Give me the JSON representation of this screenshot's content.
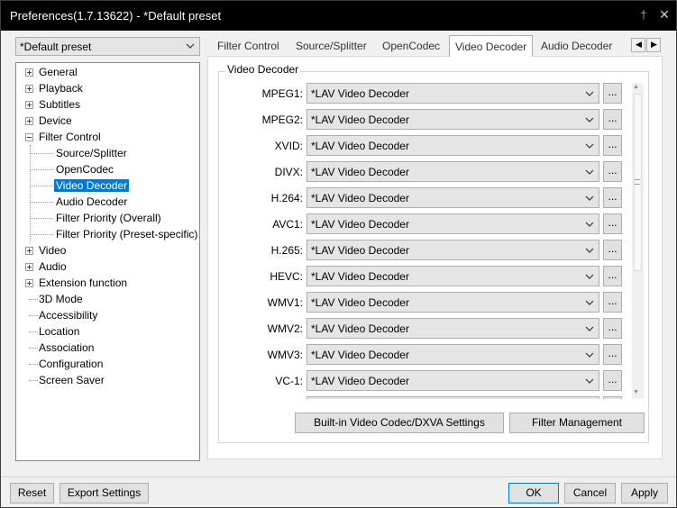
{
  "window": {
    "title": "Preferences(1.7.13622) - *Default preset"
  },
  "preset": {
    "value": "*Default preset"
  },
  "tree": {
    "items": [
      {
        "label": "General"
      },
      {
        "label": "Playback"
      },
      {
        "label": "Subtitles"
      },
      {
        "label": "Device"
      },
      {
        "label": "Filter Control"
      },
      {
        "label": "Source/Splitter"
      },
      {
        "label": "OpenCodec"
      },
      {
        "label": "Video Decoder"
      },
      {
        "label": "Audio Decoder"
      },
      {
        "label": "Filter Priority (Overall)"
      },
      {
        "label": "Filter Priority (Preset-specific)"
      },
      {
        "label": "Video"
      },
      {
        "label": "Audio"
      },
      {
        "label": "Extension function"
      },
      {
        "label": "3D Mode"
      },
      {
        "label": "Accessibility"
      },
      {
        "label": "Location"
      },
      {
        "label": "Association"
      },
      {
        "label": "Configuration"
      },
      {
        "label": "Screen Saver"
      }
    ]
  },
  "tabs": [
    {
      "label": "Filter Control"
    },
    {
      "label": "Source/Splitter"
    },
    {
      "label": "OpenCodec"
    },
    {
      "label": "Video Decoder"
    },
    {
      "label": "Audio Decoder"
    }
  ],
  "group": {
    "title": "Video Decoder"
  },
  "decoders": [
    {
      "label": "MPEG1:",
      "value": "*LAV Video Decoder"
    },
    {
      "label": "MPEG2:",
      "value": "*LAV Video Decoder"
    },
    {
      "label": "XVID:",
      "value": "*LAV Video Decoder"
    },
    {
      "label": "DIVX:",
      "value": "*LAV Video Decoder"
    },
    {
      "label": "H.264:",
      "value": "*LAV Video Decoder"
    },
    {
      "label": "AVC1:",
      "value": "*LAV Video Decoder"
    },
    {
      "label": "H.265:",
      "value": "*LAV Video Decoder"
    },
    {
      "label": "HEVC:",
      "value": "*LAV Video Decoder"
    },
    {
      "label": "WMV1:",
      "value": "*LAV Video Decoder"
    },
    {
      "label": "WMV2:",
      "value": "*LAV Video Decoder"
    },
    {
      "label": "WMV3:",
      "value": "*LAV Video Decoder"
    },
    {
      "label": "VC-1:",
      "value": "*LAV Video Decoder"
    }
  ],
  "more_label": "...",
  "buttons": {
    "builtin": "Built-in Video Codec/DXVA Settings",
    "filter_mgmt": "Filter Management",
    "reset": "Reset",
    "export": "Export Settings",
    "ok": "OK",
    "cancel": "Cancel",
    "apply": "Apply"
  },
  "icons": {
    "pin": "pin-icon",
    "close": "close-icon",
    "dropdown": "chevron-down-icon",
    "tab_left": "chevron-left-icon",
    "tab_right": "chevron-right-icon"
  },
  "colors": {
    "titlebar": "#000000",
    "selection": "#0078d7",
    "window": "#f0f0f0"
  }
}
